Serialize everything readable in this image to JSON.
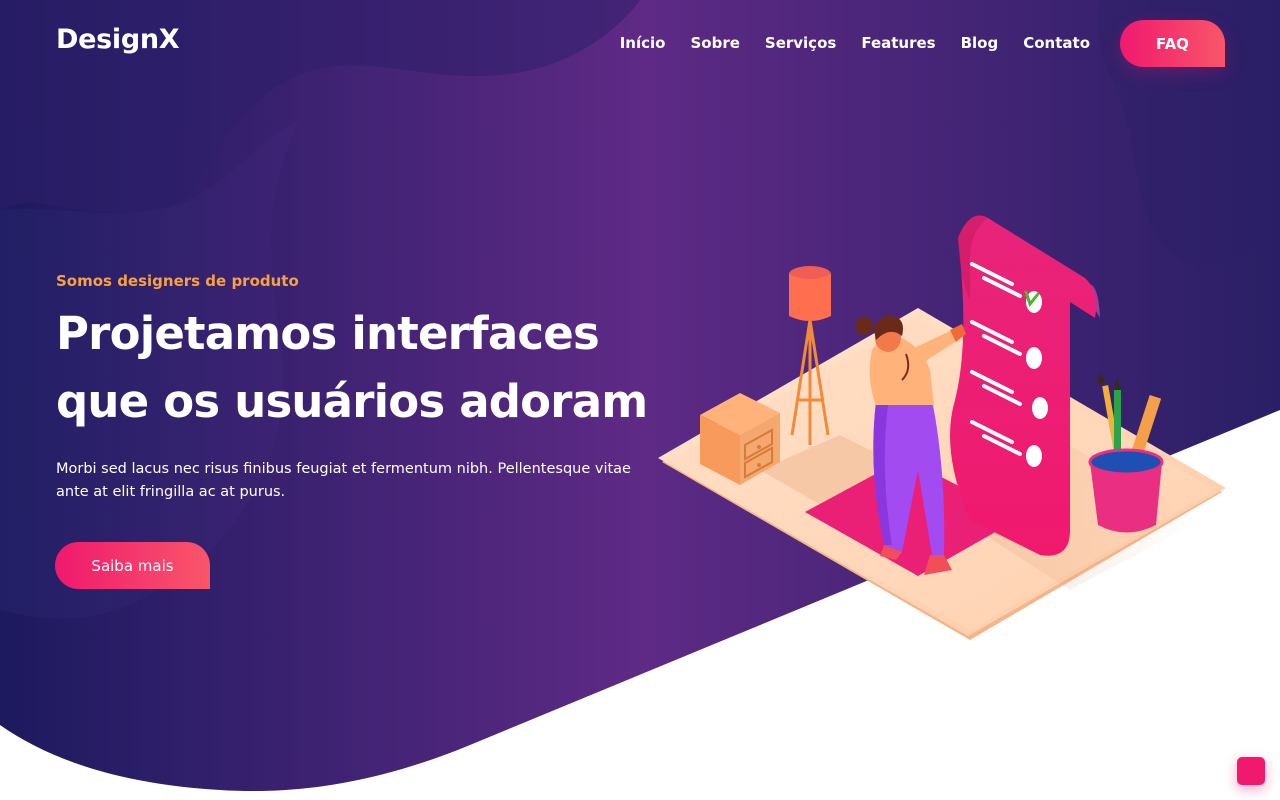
{
  "colors": {
    "brand_accent": "#f0196e",
    "accent_end": "#f9566a",
    "eyebrow": "#f7a142",
    "hero_dark": "#1d1a5f",
    "hero_purple": "#5e2a85"
  },
  "header": {
    "brand": "DesignX",
    "nav": [
      {
        "label": "Início"
      },
      {
        "label": "Sobre"
      },
      {
        "label": "Serviços"
      },
      {
        "label": "Features"
      },
      {
        "label": "Blog"
      },
      {
        "label": "Contato"
      }
    ],
    "faq_label": "FAQ"
  },
  "hero": {
    "eyebrow": "Somos designers de produto",
    "headline_line1": "Projetamos interfaces",
    "headline_line2": "que os usuários adoram",
    "lead": "Morbi sed lacus nec risus finibus feugiat et fermentum nibh. Pellentesque vitae ante at elit fringilla ac at purus.",
    "cta_label": "Saiba mais"
  },
  "illustration": {
    "icon": "designer-checklist-illustration"
  },
  "scroll_top": {
    "icon": "arrow-up-icon"
  }
}
